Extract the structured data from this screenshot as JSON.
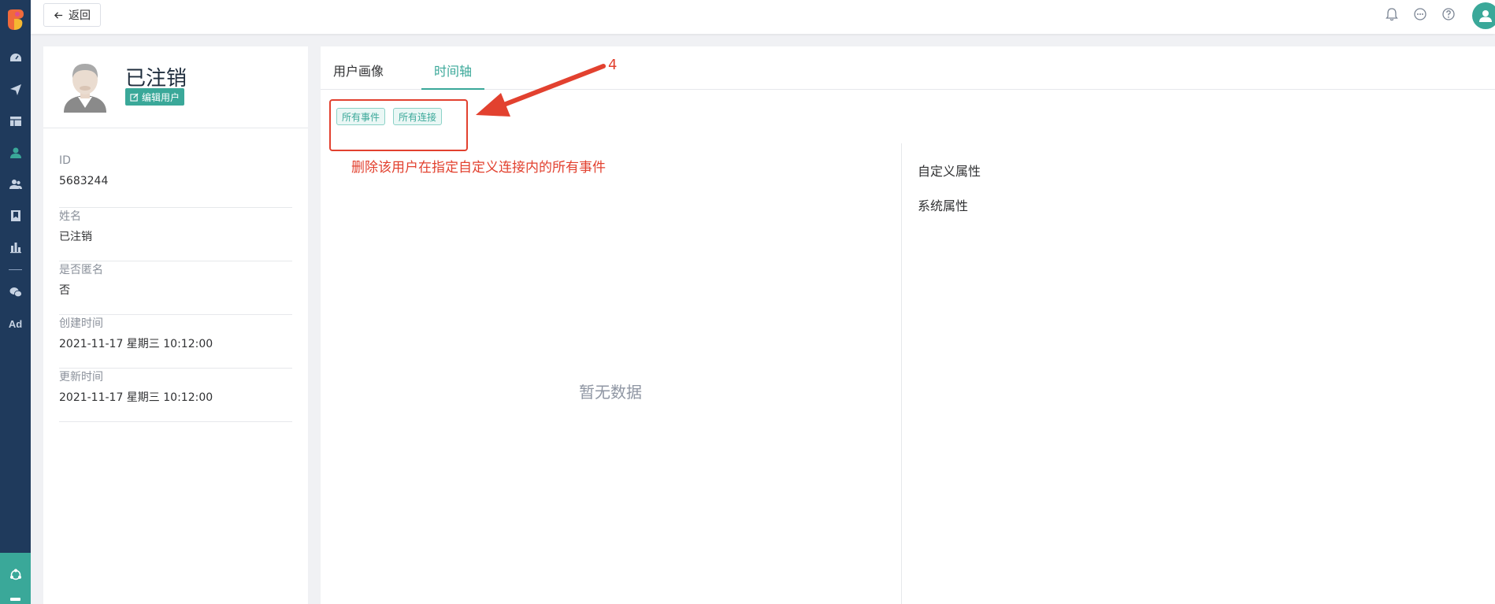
{
  "topbar": {
    "back_label": "返回"
  },
  "profile": {
    "name": "已注销",
    "edit_label": "编辑用户",
    "fields": [
      {
        "label": "ID",
        "value": "5683244"
      },
      {
        "label": "姓名",
        "value": "已注销"
      },
      {
        "label": "是否匿名",
        "value": "否"
      },
      {
        "label": "创建时间",
        "value": "2021-11-17 星期三 10:12:00"
      },
      {
        "label": "更新时间",
        "value": "2021-11-17 星期三 10:12:00"
      }
    ]
  },
  "main": {
    "tabs": [
      {
        "label": "用户画像",
        "active": false
      },
      {
        "label": "时间轴",
        "active": true
      }
    ],
    "tags": [
      "所有事件",
      "所有连接"
    ],
    "empty_text": "暂无数据",
    "attributes": [
      "自定义属性",
      "系统属性"
    ]
  },
  "annotation": {
    "number": "4",
    "text": "删除该用户在指定自定义连接内的所有事件"
  },
  "nav": {
    "ad_label": "Ad"
  },
  "colors": {
    "accent": "#3aa899",
    "nav_bg": "#1f3a5c",
    "annotation": "#e2412f"
  }
}
